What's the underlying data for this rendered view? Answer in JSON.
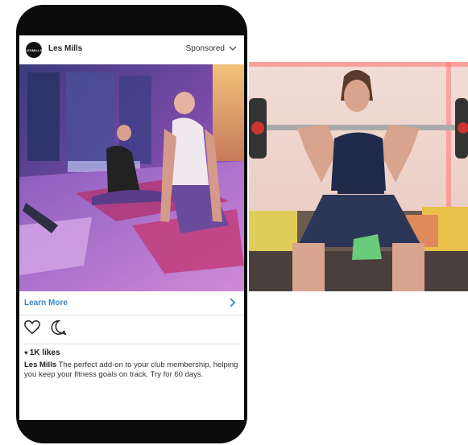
{
  "post": {
    "account": "Les Mills",
    "avatar_text": "LESMILLS",
    "sponsored": "Sponsored",
    "cta": "Learn More",
    "likes": "1K likes",
    "caption_author": "Les Mills",
    "caption_text": " The perfect add-on to your club membership, helping you keep your fitness goals on track. Try for 60 days."
  },
  "images": {
    "ad_photo": "two women doing yoga cobra pose on mats in a purple-lit living room",
    "side_photo": "woman squatting with a barbell on her shoulders in a living room with a sofa"
  },
  "icons": {
    "menu": "chevron-down-icon",
    "cta": "chevron-right-icon",
    "like": "heart-icon",
    "comment": "comment-icon"
  },
  "colors": {
    "cta_blue": "#3c88c6",
    "phone_frame": "#0b0b0b"
  }
}
